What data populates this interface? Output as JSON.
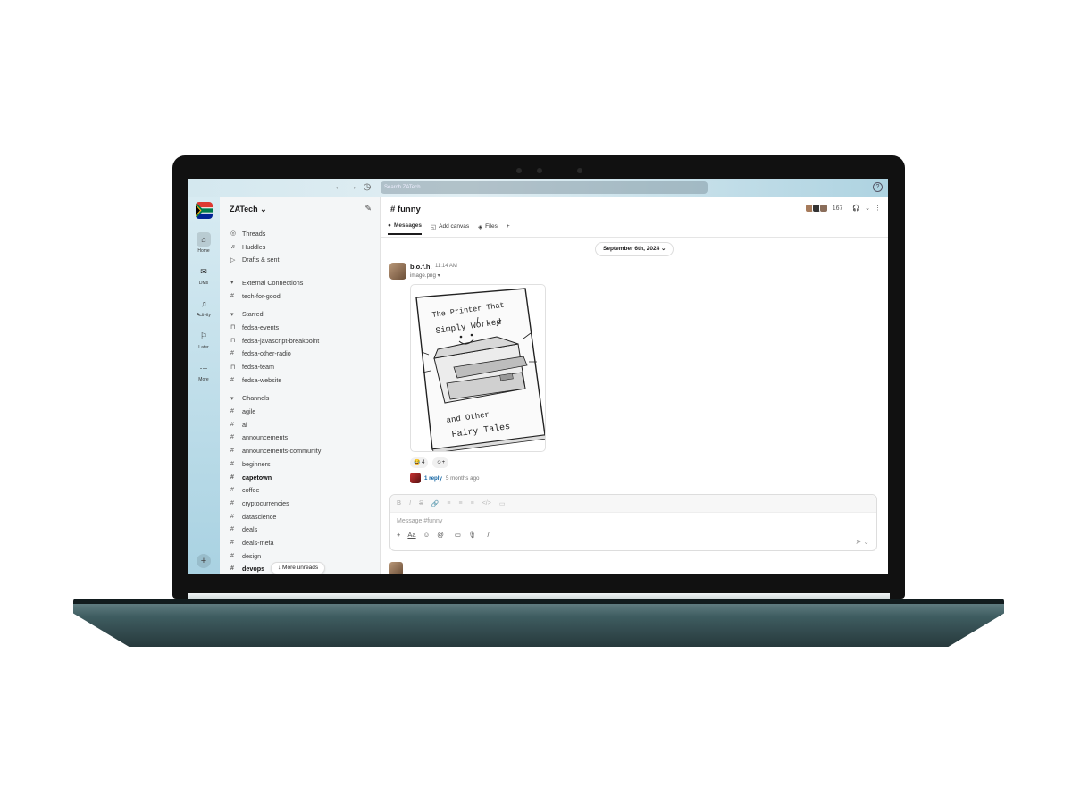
{
  "titlebar": {
    "back": "←",
    "forward": "→",
    "history": "◷",
    "search_placeholder": "Search ZATech",
    "help": "?"
  },
  "rail": {
    "items": [
      {
        "label": "Home",
        "icon": "home-icon",
        "glyph": "⌂"
      },
      {
        "label": "DMs",
        "icon": "dms-icon",
        "glyph": "✉"
      },
      {
        "label": "Activity",
        "icon": "bell-icon",
        "glyph": "♫"
      },
      {
        "label": "Later",
        "icon": "bookmark-icon",
        "glyph": "⚐"
      },
      {
        "label": "More",
        "icon": "more-icon",
        "glyph": "⋯"
      }
    ],
    "add": "+"
  },
  "workspace": {
    "name": "ZATech ⌄"
  },
  "sidebar": {
    "threads": "Threads",
    "huddles": "Huddles",
    "drafts": "Drafts & sent",
    "external_heading": "External Connections",
    "external": [
      "tech-for-good"
    ],
    "starred_heading": "Starred",
    "starred": [
      "fedsa-events",
      "fedsa-javascript-breakpoint",
      "fedsa-other-radio",
      "fedsa-team",
      "fedsa-website"
    ],
    "channels_heading": "Channels",
    "channels": [
      "agile",
      "ai",
      "announcements",
      "announcements-community",
      "beginners",
      "capetown",
      "coffee",
      "cryptocurrencies",
      "datascience",
      "deals",
      "deals-meta",
      "design",
      "devops"
    ],
    "more_unreads": "↓ More unreads"
  },
  "channel": {
    "title": "# funny",
    "member_count": "167",
    "tabs": [
      "Messages",
      "Add canvas",
      "Files"
    ],
    "add_tab": "+"
  },
  "date_divider": "September 6th, 2024 ⌄",
  "message": {
    "author": "b.o.f.h.",
    "time": "11:14 AM",
    "file_name": "image.png ▾",
    "image_text": {
      "line1": "The Printer That",
      "line2": "Simply Worked",
      "line3": "and Other",
      "line4": "Fairy Tales"
    },
    "reaction_count": "😂 4",
    "add_reaction": "☺+",
    "reply_label": "1 reply",
    "reply_time": "5 months ago"
  },
  "composer": {
    "placeholder": "Message #funny",
    "format_buttons": [
      "B",
      "I",
      "S",
      "🔗",
      "≡",
      "≡",
      "≡",
      "</>",
      "▭"
    ],
    "tools": [
      "+",
      "Aa",
      "☺",
      "@",
      "▭",
      "🎙",
      "/"
    ],
    "send": "➤ ⌄"
  }
}
